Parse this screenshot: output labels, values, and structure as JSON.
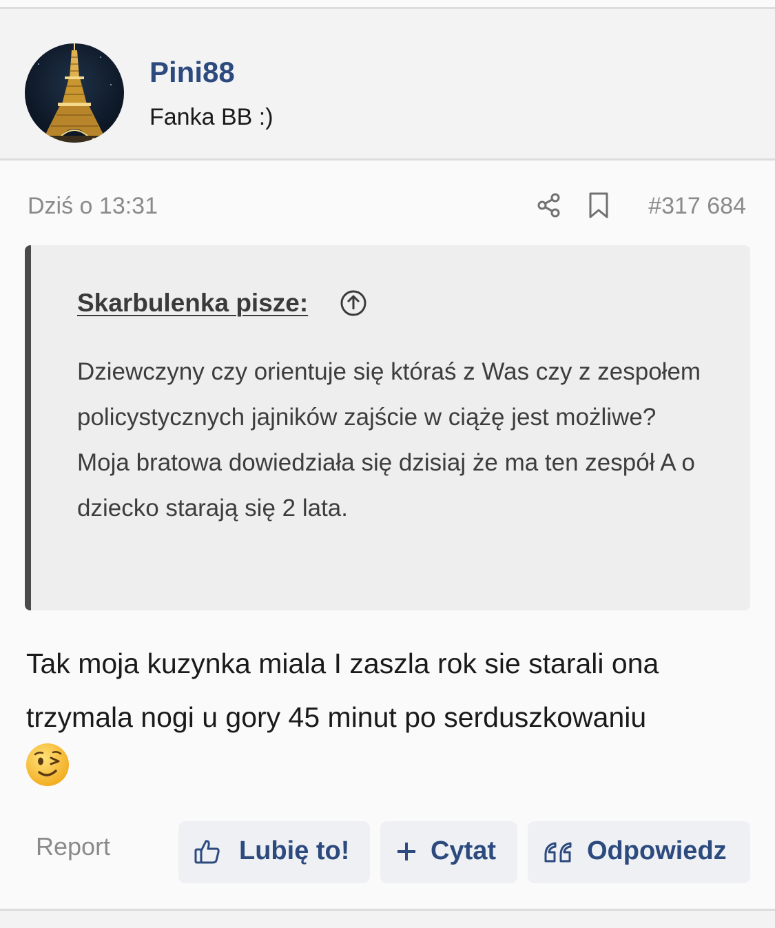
{
  "user": {
    "name": "Pini88",
    "title": "Fanka BB :)",
    "avatar_icon": "eiffel-tower-night-photo"
  },
  "post": {
    "date": "Dziś o 13:31",
    "number": "#317 684",
    "share_icon": "share-icon",
    "bookmark_icon": "bookmark-icon",
    "body": "Tak moja kuzynka miala I zaszla rok sie starali ona trzymala nogi u gory 45 minut po serduszkowaniu",
    "emoji": "winking-face"
  },
  "quote": {
    "author": "Skarbulenka pisze:",
    "text": "Dziewczyny czy orientuje się któraś z Was czy z zespołem policystycznych jajników zajście w ciążę jest możliwe?\nMoja bratowa dowiedziała się dzisiaj że ma ten zespół A o dziecko starają się 2 lata."
  },
  "actions": {
    "report": "Report",
    "like": "Lubię to!",
    "cite": "Cytat",
    "reply": "Odpowiedz"
  },
  "colors": {
    "accent": "#2c4a7e",
    "muted": "#8a8a8a",
    "quote_bar": "#4a4a4a",
    "button_bg": "#eef0f3"
  }
}
